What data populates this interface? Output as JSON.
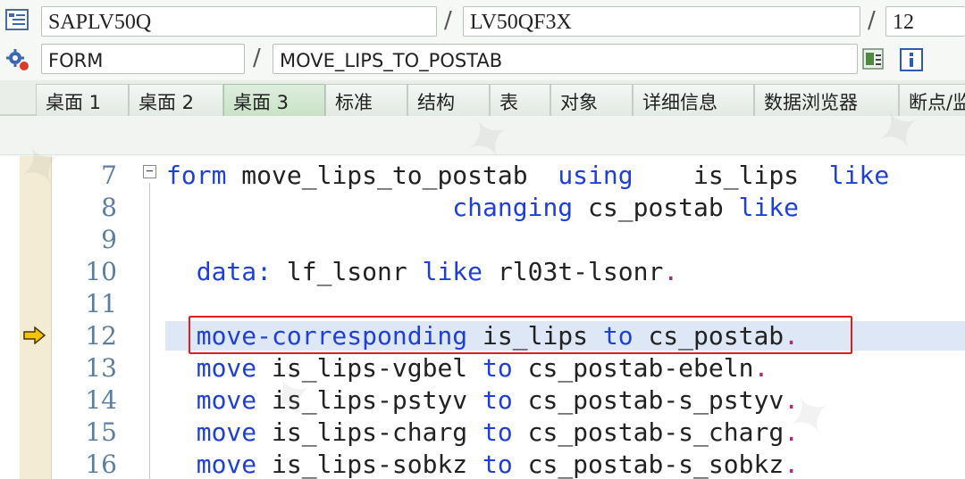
{
  "header": {
    "program": "SAPLV50Q",
    "include": "LV50QF3X",
    "line_no": "12",
    "event_type": "FORM",
    "event_name": "MOVE_LIPS_TO_POSTAB",
    "separator": "/"
  },
  "tabs": [
    {
      "label": "桌面 1",
      "active": false
    },
    {
      "label": "桌面 2",
      "active": false
    },
    {
      "label": "桌面 3",
      "active": true
    },
    {
      "label": "标准",
      "active": false
    },
    {
      "label": "结构",
      "active": false
    },
    {
      "label": "表",
      "active": false
    },
    {
      "label": "对象",
      "active": false
    },
    {
      "label": "详细信息",
      "active": false
    },
    {
      "label": "数据浏览器",
      "active": false
    },
    {
      "label": "断点/监",
      "active": false
    }
  ],
  "fold_symbol": "−",
  "code": {
    "current_line": "12",
    "lines": [
      {
        "no": "7",
        "kw1": "form",
        "t1": " move_lips_to_postab  ",
        "kw2": "using",
        "t2": "    is_lips  ",
        "kw3": "like",
        "t3": ""
      },
      {
        "no": "8",
        "kw1": "",
        "t1": "                   ",
        "kw2": "changing",
        "t2": " cs_postab ",
        "kw3": "like",
        "t3": ""
      },
      {
        "no": "9",
        "kw1": "",
        "t1": "",
        "kw2": "",
        "t2": "",
        "kw3": "",
        "t3": ""
      },
      {
        "no": "10",
        "kw1": "  data:",
        "t1": " lf_lsonr ",
        "kw2": "like",
        "t2": " rl03t-lsonr",
        "kw3": "",
        "t3": "."
      },
      {
        "no": "11",
        "kw1": "",
        "t1": "",
        "kw2": "",
        "t2": "",
        "kw3": "",
        "t3": ""
      },
      {
        "no": "12",
        "kw1": "  move-corresponding",
        "t1": " is_lips ",
        "kw2": "to",
        "t2": " cs_postab",
        "kw3": "",
        "t3": "."
      },
      {
        "no": "13",
        "kw1": "  move",
        "t1": " is_lips-vgbel ",
        "kw2": "to",
        "t2": " cs_postab-ebeln",
        "kw3": "",
        "t3": "."
      },
      {
        "no": "14",
        "kw1": "  move",
        "t1": " is_lips-pstyv ",
        "kw2": "to",
        "t2": " cs_postab-s_pstyv",
        "kw3": "",
        "t3": "."
      },
      {
        "no": "15",
        "kw1": "  move",
        "t1": " is_lips-charg ",
        "kw2": "to",
        "t2": " cs_postab-s_charg",
        "kw3": "",
        "t3": "."
      },
      {
        "no": "16",
        "kw1": "  move",
        "t1": " is_lips-sobkz ",
        "kw2": "to",
        "t2": " cs_postab-s_sobkz",
        "kw3": "",
        "t3": "."
      }
    ]
  },
  "colors": {
    "keyword": "#1f3fd6",
    "line_number": "#5b7ea3",
    "current_line_bg": "#dde7f5",
    "annotation_box": "#e02020",
    "breakpoint_gutter": "#f3ebd3"
  },
  "icons": {
    "program": "program-tree-icon",
    "event": "gear-event-icon",
    "navigate": "navigate-icon",
    "info": "info-icon",
    "current_line": "current-line-arrow-icon"
  }
}
